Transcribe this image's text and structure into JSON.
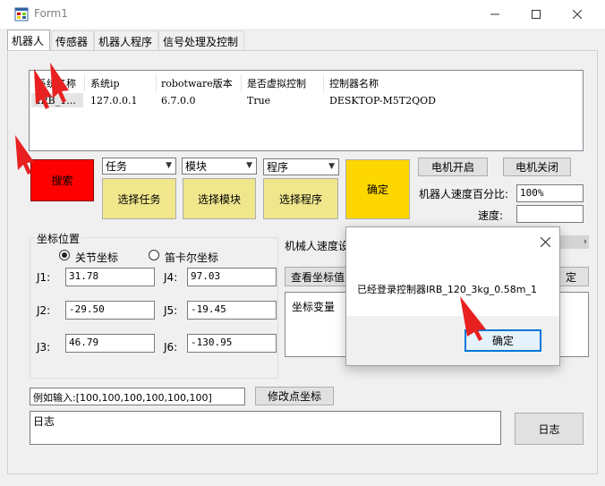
{
  "window": {
    "title": "Form1"
  },
  "tabs": [
    "机器人",
    "传感器",
    "机器人程序",
    "信号处理及控制"
  ],
  "controller_list": {
    "columns": [
      "系统名称",
      "系统ip",
      "robotware版本",
      "是否虚拟控制",
      "控制器名称"
    ],
    "rows": [
      [
        "IRB_1...",
        "127.0.0.1",
        "6.7.0.0",
        "True",
        "DESKTOP-M5T2QOD"
      ]
    ]
  },
  "buttons": {
    "search": "搜索",
    "select_task": "选择任务",
    "select_module": "选择模块",
    "select_program": "选择程序",
    "confirm": "确定",
    "motor_on": "电机开启",
    "motor_off": "电机关闭",
    "view_coords": "查看坐标值",
    "modify_point": "修改点坐标",
    "log": "日志"
  },
  "combos": {
    "task": "任务",
    "module": "模块",
    "program": "程序"
  },
  "speed": {
    "percent_label": "机器人速度百分比:",
    "percent_value": "100%",
    "speed_label": "速度:",
    "speed_value": ""
  },
  "coords": {
    "group_title": "坐标位置",
    "joint_radio": "关节坐标",
    "cartesian_radio": "笛卡尔坐标",
    "joint_selected": true,
    "joints": [
      {
        "label": "J1:",
        "value": "31.78"
      },
      {
        "label": "J2:",
        "value": "-29.50"
      },
      {
        "label": "J3:",
        "value": "46.79"
      },
      {
        "label": "J4:",
        "value": "97.03"
      },
      {
        "label": "J5:",
        "value": "-19.45"
      },
      {
        "label": "J6:",
        "value": "-130.95"
      }
    ]
  },
  "robot_speed_label": "机械人速度设",
  "coord_change_label": "坐标变量",
  "hidden_button_fragment": "定",
  "input_example": "例如输入:[100,100,100,100,100,100]",
  "log_box": "日志",
  "dialog": {
    "message": "已经登录控制器IRB_120_3kg_0.58m_1",
    "ok": "确定",
    "close_icon": "close-icon"
  },
  "colors": {
    "search_red": "#ff0000",
    "select_yellow": "#f0e68c",
    "confirm_gold": "#ffd700",
    "arrow_red": "#e82020"
  }
}
